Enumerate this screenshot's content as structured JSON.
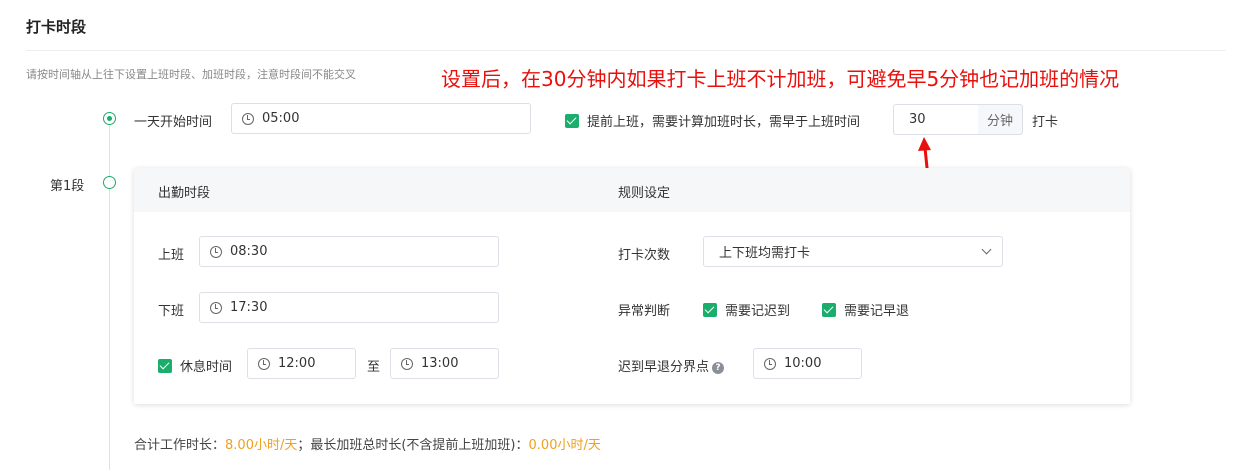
{
  "page": {
    "title": "打卡时段",
    "hint": "请按时间轴从上往下设置上班时段、加班时段，注意时段间不能交叉",
    "annotation": "设置后，在30分钟内如果打卡上班不计加班，可避免早5分钟也记加班的情况"
  },
  "day_start": {
    "label": "一天开始时间",
    "value": "05:00"
  },
  "early_checkin": {
    "checked": true,
    "label": "提前上班，需要计算加班时长，需早于上班时间",
    "minutes": "30",
    "unit": "分钟",
    "suffix": "打卡"
  },
  "segment": {
    "label": "第1段",
    "header_left": "出勤时段",
    "header_right": "规则设定",
    "on_duty": {
      "label": "上班",
      "value": "08:30"
    },
    "off_duty": {
      "label": "下班",
      "value": "17:30"
    },
    "break": {
      "checked": true,
      "label": "休息时间",
      "start": "12:00",
      "sep": "至",
      "end": "13:00"
    },
    "punch_times": {
      "label": "打卡次数",
      "value": "上下班均需打卡"
    },
    "exception": {
      "label": "异常判断",
      "late_label": "需要记迟到",
      "early_label": "需要记早退",
      "late_checked": true,
      "early_checked": true
    },
    "threshold": {
      "label": "迟到早退分界点",
      "help": "?",
      "value": "10:00"
    }
  },
  "summary": {
    "work_label": "合计工作时长：",
    "work_value": "8.00小时/天",
    "sep": "；",
    "ot_label": "最长加班总时长(不含提前上班加班)：",
    "ot_value": "0.00小时/天"
  },
  "colors": {
    "accent": "#1aad6b",
    "annotation": "#e8100c",
    "highlight": "#f0a020"
  }
}
